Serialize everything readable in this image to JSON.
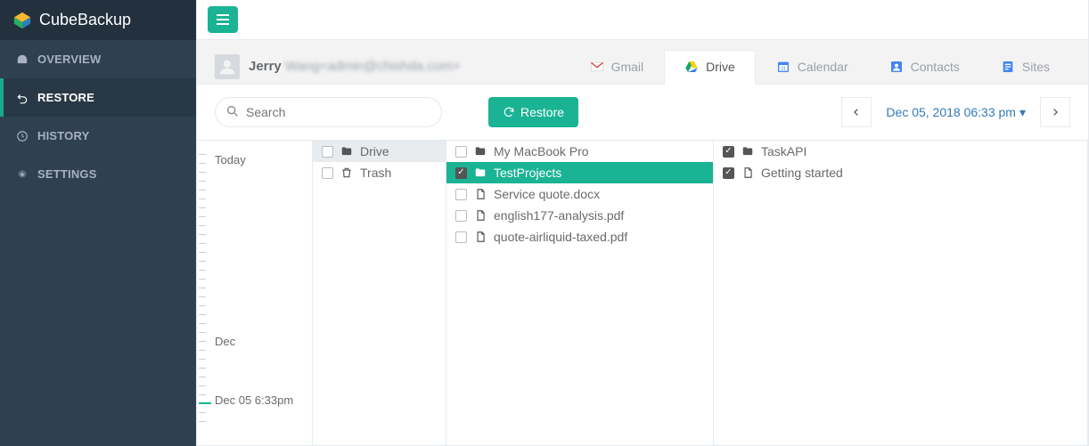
{
  "brand": {
    "name": "CubeBackup"
  },
  "nav": {
    "overview": "OVERVIEW",
    "restore": "RESTORE",
    "history": "HISTORY",
    "settings": "SETTINGS"
  },
  "user": {
    "first_name": "Jerry",
    "rest_blurred": "Wang<admin@chishda.com>"
  },
  "tabs": {
    "gmail": "Gmail",
    "drive": "Drive",
    "calendar": "Calendar",
    "contacts": "Contacts",
    "sites": "Sites"
  },
  "search": {
    "placeholder": "Search"
  },
  "restore_btn": "Restore",
  "snapshot": {
    "label": "Dec 05, 2018 06:33 pm",
    "caret": "▾"
  },
  "timeline": {
    "today": "Today",
    "month": "Dec",
    "current": "Dec 05 6:33pm"
  },
  "col1": {
    "items": [
      {
        "label": "Drive",
        "icon": "folder",
        "selected": true
      },
      {
        "label": "Trash",
        "icon": "trash"
      }
    ]
  },
  "col2": {
    "items": [
      {
        "label": "My MacBook Pro",
        "icon": "folder",
        "checked": false
      },
      {
        "label": "TestProjects",
        "icon": "folder",
        "checked": true,
        "highlight": true
      },
      {
        "label": "Service quote.docx",
        "icon": "doc",
        "checked": false
      },
      {
        "label": "english177-analysis.pdf",
        "icon": "doc",
        "checked": false
      },
      {
        "label": "quote-airliquid-taxed.pdf",
        "icon": "doc",
        "checked": false
      }
    ]
  },
  "col3": {
    "items": [
      {
        "label": "TaskAPI",
        "icon": "folder",
        "checked": true
      },
      {
        "label": "Getting started",
        "icon": "doc",
        "checked": true
      }
    ]
  }
}
